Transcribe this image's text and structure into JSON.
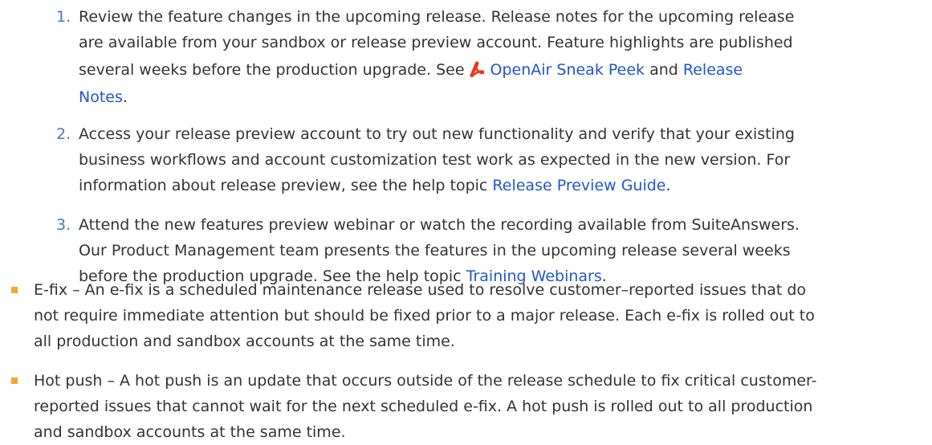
{
  "numbered_list": [
    {
      "marker": "1.",
      "line1": "Review the feature changes in the upcoming release. Release notes for the upcoming release",
      "line2": "are available from your sandbox or release preview account. Feature highlights are published",
      "line3_pre": "several weeks before the production upgrade. See",
      "link_sneak_peek": "OpenAir Sneak Peek",
      "line3_mid": "and",
      "link_release": "Release",
      "link_notes": "Notes",
      "line4_post": "."
    },
    {
      "marker": "2.",
      "line1": "Access your release preview account to try out new functionality and verify that your existing",
      "line2": "business workflows and account customization test work as expected in the new version. For",
      "line3_pre": "information about release preview, see the help topic",
      "link": "Release Preview Guide",
      "line3_post": "."
    },
    {
      "marker": "3.",
      "line1": "Attend the new features preview webinar or watch the recording available from SuiteAnswers.",
      "line2": "Our Product Management team presents the features in the upcoming release several weeks",
      "line3_pre": "before the production upgrade. See the help topic",
      "link": "Training Webinars",
      "line3_post": "."
    }
  ],
  "bullet_list": [
    {
      "line1": "E-fix – An e-fix is a scheduled maintenance release used to resolve customer–reported issues that do",
      "line2": "not require immediate attention but should be fixed prior to a major release. Each e-fix is rolled out to",
      "line3": "all production and sandbox accounts at the same time."
    },
    {
      "line1": "Hot push – A hot push is an update that occurs outside of the release schedule to fix critical customer-",
      "line2": "reported issues that cannot wait for the next scheduled e-fix. A hot push is rolled out to all production",
      "line3": "and sandbox accounts at the same time."
    }
  ],
  "colors": {
    "text": "#333333",
    "link": "#2255cc",
    "number_marker": "#4a78b8",
    "bullet": "#f0a830",
    "pdf_icon": "#e8391e"
  },
  "icons": {
    "pdf": "pdf-icon"
  }
}
